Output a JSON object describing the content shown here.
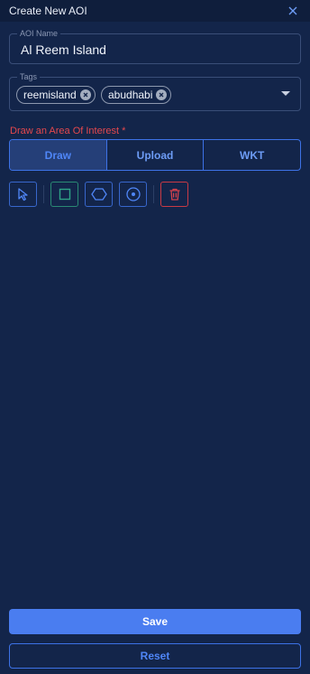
{
  "header": {
    "title": "Create New AOI",
    "close_icon": "close-icon"
  },
  "aoi_name": {
    "label": "AOI Name",
    "value": "Al Reem Island"
  },
  "tags": {
    "label": "Tags",
    "chips": [
      {
        "label": "reemisland"
      },
      {
        "label": "abudhabi"
      }
    ]
  },
  "draw_section": {
    "label": "Draw an Area Of Interest *",
    "tabs": [
      {
        "label": "Draw",
        "active": true
      },
      {
        "label": "Upload",
        "active": false
      },
      {
        "label": "WKT",
        "active": false
      }
    ],
    "tools": [
      {
        "icon": "pointer-icon"
      },
      {
        "icon": "rectangle-icon"
      },
      {
        "icon": "polygon-icon"
      },
      {
        "icon": "circle-icon"
      },
      {
        "icon": "trash-icon"
      }
    ]
  },
  "actions": {
    "save_label": "Save",
    "reset_label": "Reset"
  },
  "colors": {
    "background": "#13254a",
    "accent": "#4a7df0",
    "required": "#e5484d",
    "danger": "#c83a45",
    "shape_tool": "#2a8a74"
  }
}
